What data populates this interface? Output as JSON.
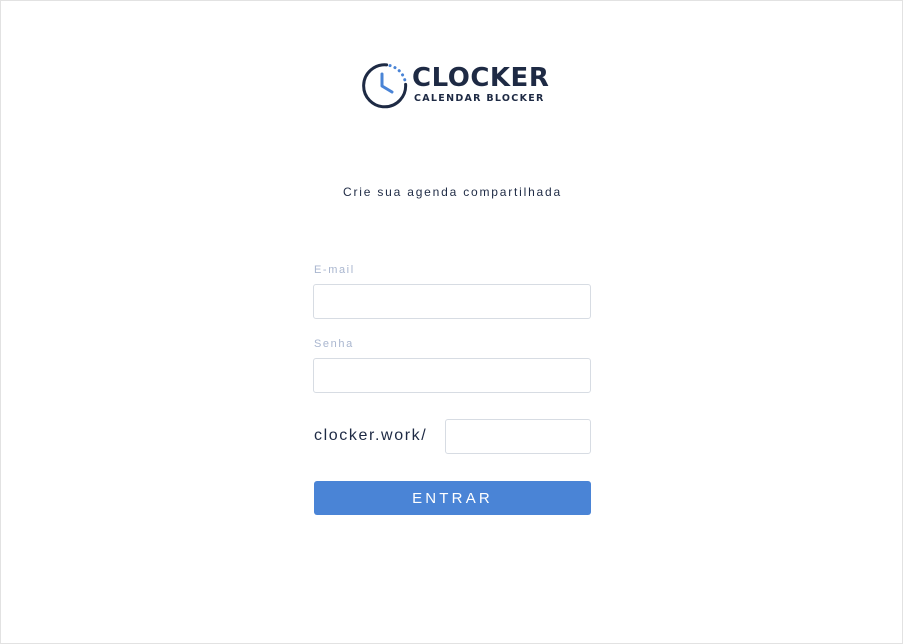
{
  "brand": {
    "name": "CLOCKER",
    "tagline": "CALENDAR BLOCKER",
    "icon": "clock-icon",
    "primary_color": "#1e2a44",
    "accent_color": "#4a84d6"
  },
  "subtitle": "Crie sua agenda compartilhada",
  "form": {
    "email": {
      "label": "E-mail",
      "value": "",
      "placeholder": ""
    },
    "password": {
      "label": "Senha",
      "value": "",
      "placeholder": ""
    },
    "username": {
      "prefix": "clocker.work/",
      "value": "",
      "placeholder": ""
    },
    "submit_label": "ENTRAR"
  }
}
